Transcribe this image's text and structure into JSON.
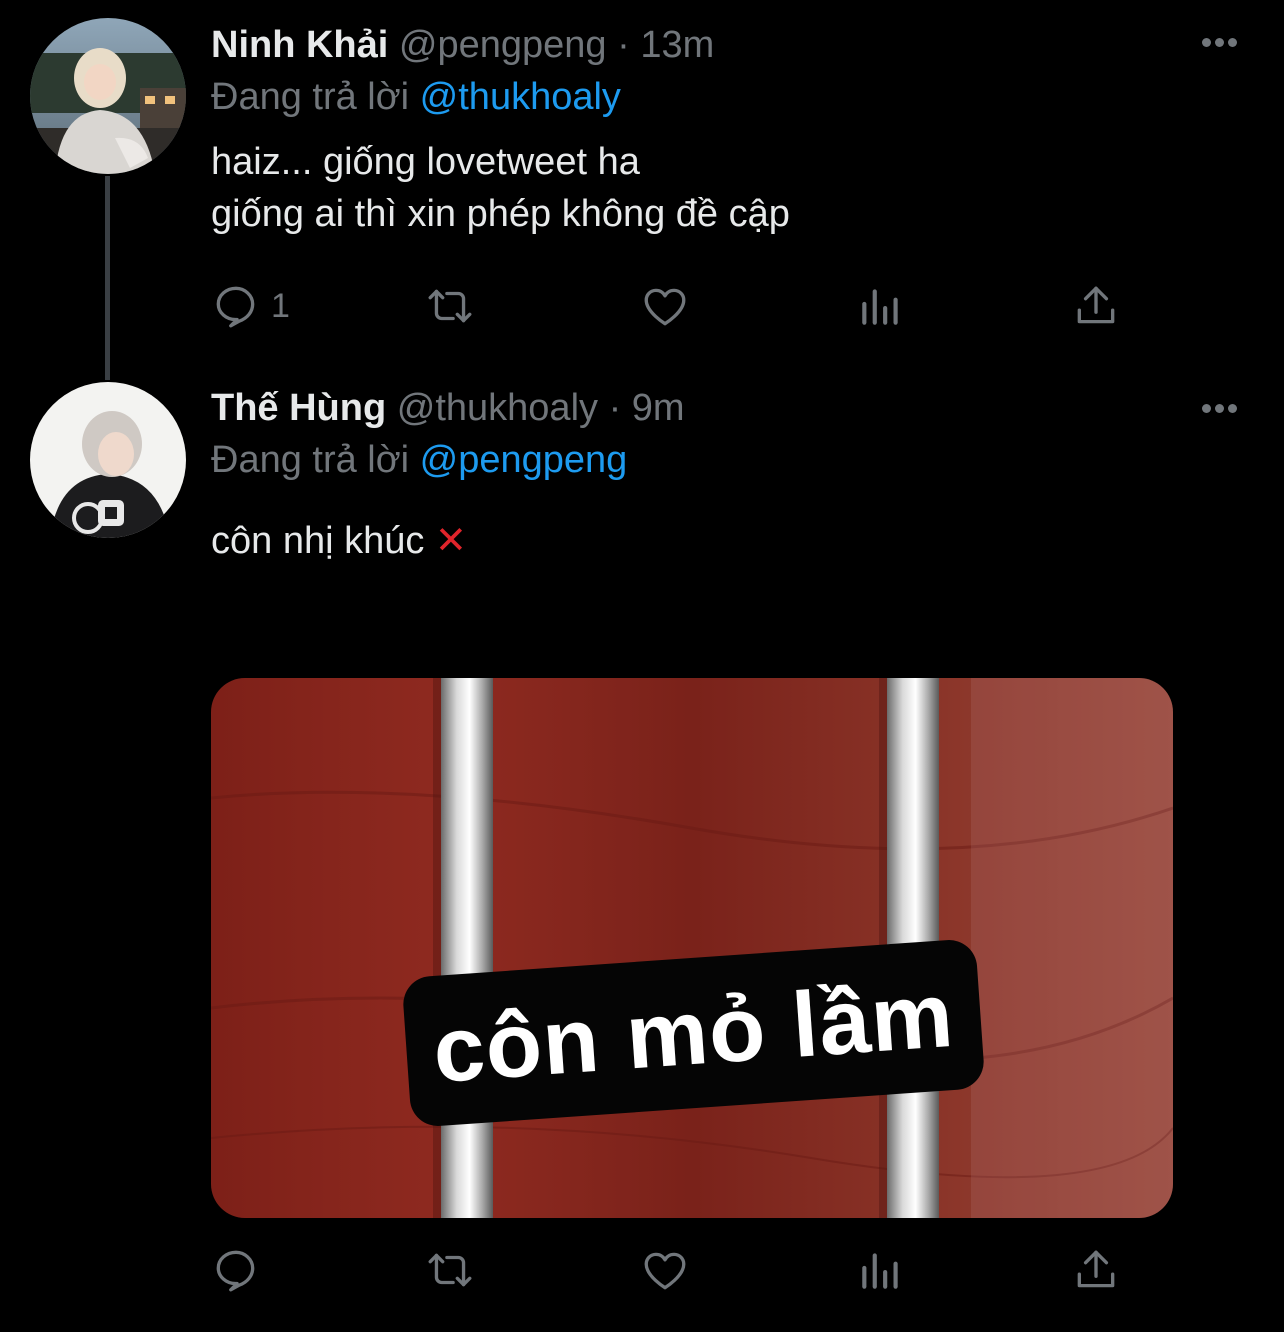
{
  "tweets": [
    {
      "name": "Ninh Khải",
      "handle": "@pengpeng",
      "separator": "·",
      "time": "13m",
      "replying_prefix": "Đang trả lời",
      "replying_to": "@thukhoaly",
      "lines": [
        "haiz... giống lovetweet ha",
        "giống ai thì xin phép không đề cập"
      ],
      "reply_count": "1",
      "avatar_icon": "profile-photo"
    },
    {
      "name": "Thế Hùng",
      "handle": "@thukhoaly",
      "separator": "·",
      "time": "9m",
      "replying_prefix": "Đang trả lời",
      "replying_to": "@pengpeng",
      "text": "côn nhị khúc",
      "emoji": "❌",
      "media_caption": "côn mỏ lầm",
      "avatar_icon": "profile-photo"
    }
  ],
  "icons": {
    "reply": "reply-icon",
    "retweet": "retweet-icon",
    "like": "heart-icon",
    "views": "views-icon",
    "share": "share-icon",
    "more": "more-icon"
  },
  "colors": {
    "background": "#000000",
    "text": "#e7e9ea",
    "secondary": "#71767b",
    "link": "#1d9bf0",
    "emoji_cross": "#e0242b"
  }
}
